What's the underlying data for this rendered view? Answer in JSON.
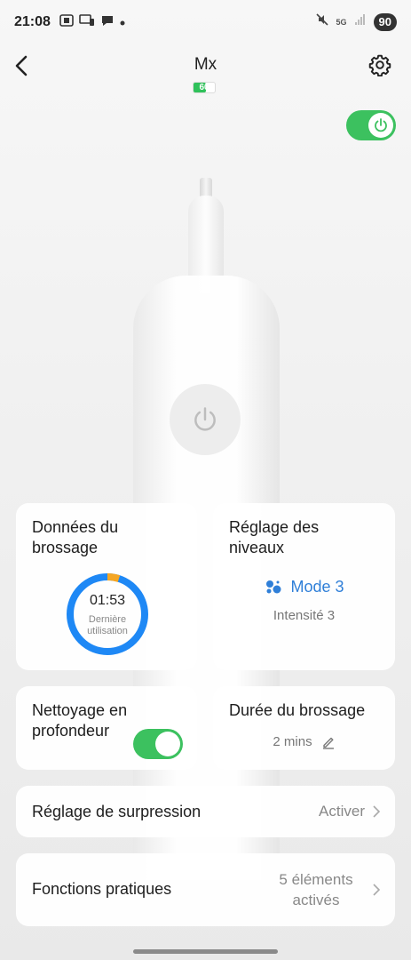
{
  "status_bar": {
    "time": "21:08",
    "network": "5G",
    "battery": "90"
  },
  "header": {
    "title": "Mx",
    "battery_percent": "60",
    "battery_level": 0.6
  },
  "power_toggle": {
    "on": true
  },
  "cards": {
    "brushing_data": {
      "title": "Données du brossage",
      "time": "01:53",
      "label": "Dernière utilisation",
      "progress": 0.05
    },
    "level_setting": {
      "title": "Réglage des niveaux",
      "mode": "Mode 3",
      "intensity": "Intensité 3"
    },
    "deep_cleaning": {
      "title": "Nettoyage en profondeur",
      "enabled": true
    },
    "brushing_duration": {
      "title": "Durée du brossage",
      "value": "2 mins"
    }
  },
  "rows": {
    "suppression": {
      "label": "Réglage de surpression",
      "value": "Activer"
    },
    "functions": {
      "label": "Fonctions pratiques",
      "value": "5 éléments activés"
    }
  },
  "colors": {
    "accent_green": "#3cc15f",
    "accent_blue": "#2f7fd8",
    "ring_orange": "#f5a623"
  },
  "icons": [
    "back-arrow-icon",
    "gear-icon",
    "power-icon",
    "chevron-right-icon",
    "edit-pencil-icon",
    "mode-bubbles-icon"
  ]
}
